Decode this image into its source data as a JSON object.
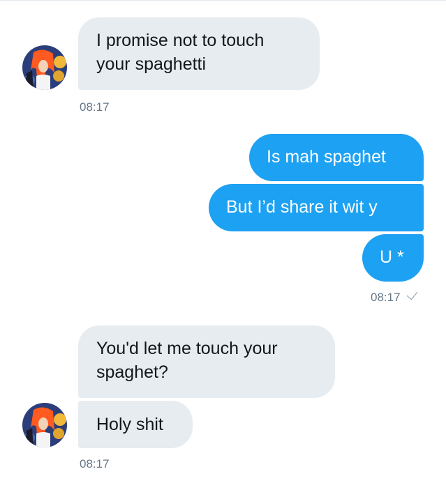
{
  "conversation": {
    "messages": [
      {
        "direction": "received",
        "text_lines": [
          "I promise not to touch",
          "your spaghetti"
        ]
      },
      {
        "direction": "sent",
        "text": "Is mah spaghet"
      },
      {
        "direction": "sent",
        "text": "But I’d share it wit y"
      },
      {
        "direction": "sent",
        "text": "U *"
      },
      {
        "direction": "received",
        "text_lines": [
          "You'd let me touch your",
          "spaghet?"
        ]
      },
      {
        "direction": "received",
        "text": "Holy shit"
      }
    ],
    "timestamps": {
      "first": "08:17",
      "sent_group": "08:17",
      "last": "08:17"
    },
    "read_receipt_icon": "checkmark-icon",
    "colors": {
      "sent_bubble": "#1da1f2",
      "received_bubble": "#e6ecf0",
      "timestamp": "#657786"
    }
  }
}
